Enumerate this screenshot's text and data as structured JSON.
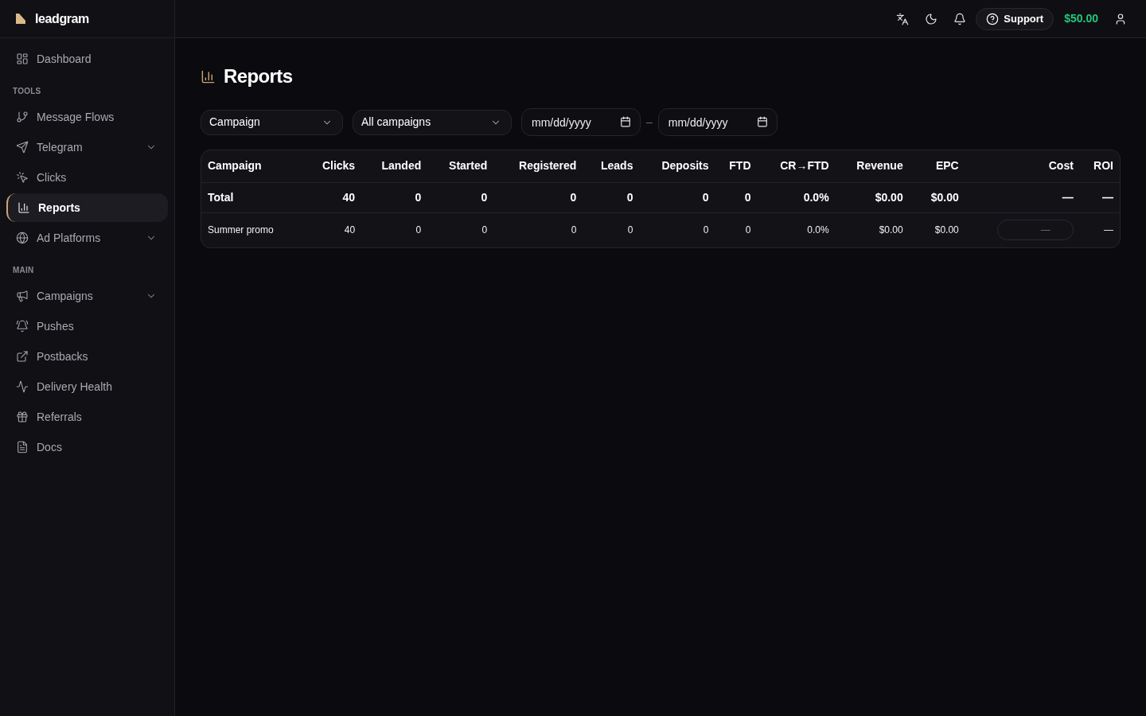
{
  "brand": {
    "name": "leadgram"
  },
  "sidebar": {
    "items": [
      {
        "label": "Dashboard",
        "kind": "link",
        "selected": false
      }
    ],
    "sections": [
      {
        "label": "TOOLS",
        "items": [
          {
            "label": "Message Flows",
            "kind": "link",
            "selected": false
          },
          {
            "label": "Telegram",
            "kind": "group",
            "selected": false
          },
          {
            "label": "Clicks",
            "kind": "link",
            "selected": false
          },
          {
            "label": "Reports",
            "kind": "link",
            "selected": true
          },
          {
            "label": "Ad Platforms",
            "kind": "group",
            "selected": false
          }
        ]
      },
      {
        "label": "MAIN",
        "items": [
          {
            "label": "Campaigns",
            "kind": "group",
            "selected": false
          },
          {
            "label": "Pushes",
            "kind": "link",
            "selected": false
          },
          {
            "label": "Postbacks",
            "kind": "link",
            "selected": false
          },
          {
            "label": "Delivery Health",
            "kind": "link",
            "selected": false
          },
          {
            "label": "Referrals",
            "kind": "link",
            "selected": false
          },
          {
            "label": "Docs",
            "kind": "link",
            "selected": false
          }
        ]
      }
    ]
  },
  "header": {
    "support_button": "Support",
    "balance": "$50.00"
  },
  "page": {
    "title": "Reports"
  },
  "filters": {
    "group_by": {
      "value": "Campaign"
    },
    "campaign": {
      "value": "All campaigns"
    },
    "date_from": {
      "placeholder": "mm/dd/yyyy"
    },
    "separator": "–",
    "date_to": {
      "placeholder": "mm/dd/yyyy"
    }
  },
  "table": {
    "columns": [
      "Campaign",
      "Clicks",
      "Landed",
      "Started",
      "Registered",
      "Leads",
      "Deposits",
      "FTD",
      "CR→FTD",
      "Revenue",
      "EPC",
      "Cost",
      "ROI"
    ],
    "rows": [
      {
        "kind": "total",
        "cells": [
          "Total",
          "40",
          "0",
          "0",
          "0",
          "0",
          "0",
          "0",
          "0.0%",
          "$0.00",
          "$0.00",
          "—",
          "—"
        ]
      },
      {
        "kind": "campaign",
        "cells": [
          "Summer promo",
          "40",
          "0",
          "0",
          "0",
          "0",
          "0",
          "0",
          "0.0%",
          "$0.00",
          "$0.00",
          {
            "placeholder": "—"
          },
          "—"
        ]
      }
    ]
  }
}
